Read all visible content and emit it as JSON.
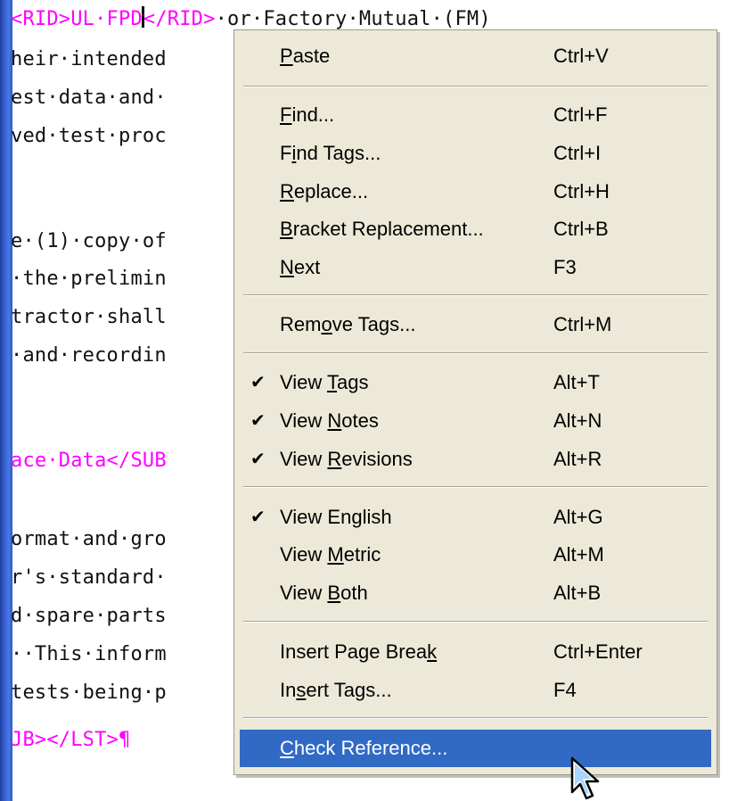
{
  "editor": {
    "lines": [
      {
        "pre": "",
        "tag1": "<RID>UL·FPD",
        "caret": true,
        "tag2": "</RID>",
        "post": "·or·Factory·Mutual·(FM)"
      },
      {
        "pre": "heir·intended"
      },
      {
        "pre": "est·data·and·"
      },
      {
        "pre": "ved·test·proc"
      },
      {
        "pre": ""
      },
      {
        "pre": "e·(1)·copy·of"
      },
      {
        "pre": "·the·prelimin"
      },
      {
        "pre": "tractor·shall"
      },
      {
        "pre": "·and·recordin"
      },
      {
        "pre": ""
      },
      {
        "pre": "ace·Data</SUB"
      },
      {
        "pre": ""
      },
      {
        "pre": "ormat·and·gro"
      },
      {
        "pre": "r's·standard·"
      },
      {
        "pre": "d·spare·parts"
      },
      {
        "pre": "··This·inform"
      },
      {
        "pre": "tests·being·p"
      },
      {
        "pre": ""
      },
      {
        "pre": "JB></LST>¶"
      }
    ]
  },
  "menu": {
    "items": [
      {
        "label": "Paste",
        "underline": 0,
        "shortcut": "Ctrl+V",
        "checked": false
      },
      {
        "label": "Find...",
        "underline": 0,
        "shortcut": "Ctrl+F",
        "checked": false
      },
      {
        "label": "Find Tags...",
        "underline": 1,
        "shortcut": "Ctrl+I",
        "checked": false
      },
      {
        "label": "Replace...",
        "underline": 0,
        "shortcut": "Ctrl+H",
        "checked": false
      },
      {
        "label": "Bracket Replacement...",
        "underline": 0,
        "shortcut": "Ctrl+B",
        "checked": false
      },
      {
        "label": "Next",
        "underline": 0,
        "shortcut": "F3",
        "checked": false
      },
      {
        "label": "Remove Tags...",
        "underline": 3,
        "shortcut": "Ctrl+M",
        "checked": false
      },
      {
        "label": "View Tags",
        "underline": 5,
        "shortcut": "Alt+T",
        "checked": true
      },
      {
        "label": "View Notes",
        "underline": 5,
        "shortcut": "Alt+N",
        "checked": true
      },
      {
        "label": "View Revisions",
        "underline": 5,
        "shortcut": "Alt+R",
        "checked": true
      },
      {
        "label": "View English",
        "underline": 7,
        "shortcut": "Alt+G",
        "checked": true
      },
      {
        "label": "View Metric",
        "underline": 5,
        "shortcut": "Alt+M",
        "checked": false
      },
      {
        "label": "View Both",
        "underline": 5,
        "shortcut": "Alt+B",
        "checked": false
      },
      {
        "label": "Insert Page Break",
        "underline": 16,
        "shortcut": "Ctrl+Enter",
        "checked": false
      },
      {
        "label": "Insert Tags...",
        "underline": 2,
        "shortcut": "F4",
        "checked": false
      },
      {
        "label": "Check Reference...",
        "underline": 0,
        "shortcut": "",
        "checked": false,
        "highlighted": true
      }
    ],
    "check_glyph": "✔"
  }
}
